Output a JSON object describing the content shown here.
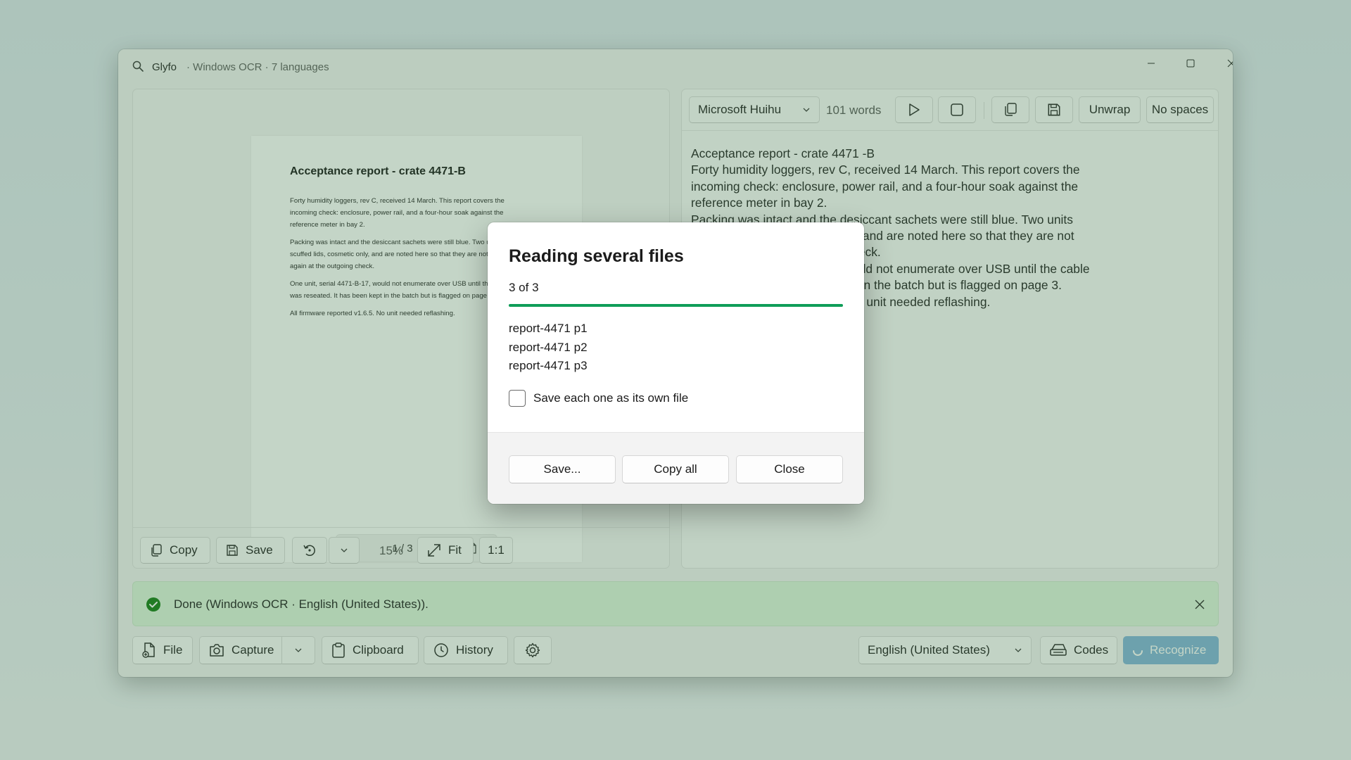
{
  "window": {
    "app_name": "Glyfo",
    "subtitle": "· Windows OCR · 7 languages"
  },
  "preview": {
    "doc_title": "Acceptance report - crate 4471-B",
    "doc_paragraphs": [
      "Forty humidity loggers, rev C, received 14 March. This report covers the incoming check: enclosure, power rail, and a four-hour soak against the reference meter in bay 2.",
      "Packing was intact and the desiccant sachets were still blue. Two units had scuffed lids, cosmetic only, and are noted here so that they are not raised again at the outgoing check.",
      "One unit, serial 4471-B-17, would not enumerate over USB until the cable was reseated. It has been kept in the batch but is flagged on page 3.",
      "All firmware reported v1.6.5. No unit needed reflashing."
    ],
    "page_indicator": "1 / 3",
    "toolbar": {
      "copy_label": "Copy",
      "save_label": "Save",
      "zoom_value": "15%",
      "fit_label": "Fit",
      "actual_size_label": "1:1"
    }
  },
  "editor": {
    "voice_name": "Microsoft Huihu",
    "word_count": "101 words",
    "unwrap_label": "Unwrap",
    "no_spaces_label": "No spaces",
    "text_lines": [
      "Acceptance report - crate 4471 -B",
      "Forty humidity loggers, rev C, received 14 March. This report covers the",
      "incoming check: enclosure, power rail, and a four-hour soak against the",
      "reference meter in bay 2.",
      "Packing was intact and the desiccant sachets were still blue. Two units",
      "had scuffed lids, cosmetic only, and are noted here so that they are not",
      "raised again at the outgoing check.",
      "One unit, serial 4471-B-17, would not enumerate over USB until the cable",
      "was reseated. It has been kept in the batch but is flagged on page 3.",
      "All firmware reported v1.6.5. No unit needed reflashing."
    ]
  },
  "status": {
    "message": "Done (Windows OCR · English (United States))."
  },
  "bottom_bar": {
    "file_label": "File",
    "capture_label": "Capture",
    "clipboard_label": "Clipboard",
    "history_label": "History",
    "language_value": "English (United States)",
    "codes_label": "Codes",
    "recognize_label": "Recognize"
  },
  "dialog": {
    "title": "Reading several files",
    "progress_text": "3 of 3",
    "progress_fraction": 1.0,
    "files": [
      "report-4471 p1",
      "report-4471 p2",
      "report-4471 p3"
    ],
    "checkbox_label": "Save each one as its own file",
    "checkbox_checked": false,
    "save_label": "Save...",
    "copy_all_label": "Copy all",
    "close_label": "Close"
  },
  "colors": {
    "accent_green": "#0f9d58",
    "status_background": "#dff6dd",
    "overlay_tint": "#487c50"
  }
}
